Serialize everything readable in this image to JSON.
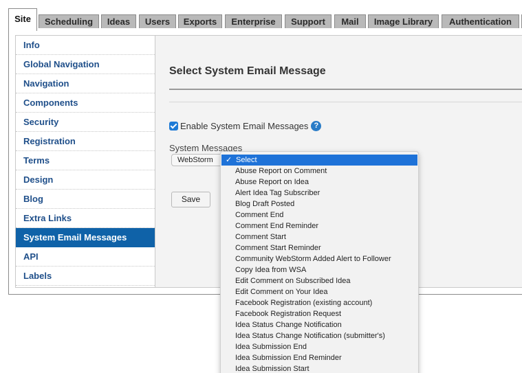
{
  "tabs": [
    {
      "label": "Site",
      "active": true
    },
    {
      "label": "Scheduling"
    },
    {
      "label": "Ideas"
    },
    {
      "label": "Users"
    },
    {
      "label": "Exports"
    },
    {
      "label": "Enterprise"
    },
    {
      "label": "Support"
    },
    {
      "label": "Mail"
    },
    {
      "label": "Image Library"
    },
    {
      "label": "Authentication"
    }
  ],
  "sidebar": {
    "items": [
      {
        "label": "Info"
      },
      {
        "label": "Global Navigation"
      },
      {
        "label": "Navigation"
      },
      {
        "label": "Components"
      },
      {
        "label": "Security"
      },
      {
        "label": "Registration"
      },
      {
        "label": "Terms"
      },
      {
        "label": "Design"
      },
      {
        "label": "Blog"
      },
      {
        "label": "Extra Links"
      },
      {
        "label": "System Email Messages",
        "active": true
      },
      {
        "label": "API"
      },
      {
        "label": "Labels"
      }
    ]
  },
  "main": {
    "title": "Select System Email Message",
    "enable_label": "Enable System Email Messages",
    "enable_checked": true,
    "help_glyph": "?",
    "system_messages_label": "System Messages",
    "select_value": "WebStorm",
    "save_label": "Save"
  },
  "dropdown": {
    "check_glyph": "✓",
    "selected_index": 0,
    "options": [
      "Select",
      "Abuse Report on Comment",
      "Abuse Report on Idea",
      "Alert Idea Tag Subscriber",
      "Blog Draft Posted",
      "Comment End",
      "Comment End Reminder",
      "Comment Start",
      "Comment Start Reminder",
      "Community WebStorm Added Alert to Follower",
      "Copy Idea from WSA",
      "Edit Comment on Subscribed Idea",
      "Edit Comment on Your Idea",
      "Facebook Registration (existing account)",
      "Facebook Registration Request",
      "Idea Status Change Notification",
      "Idea Status Change Notification (submitter's)",
      "Idea Submission End",
      "Idea Submission End Reminder",
      "Idea Submission Start"
    ]
  },
  "colors": {
    "accent": "#0f62a8",
    "link": "#1f4f8a",
    "selection": "#1e72d8"
  }
}
